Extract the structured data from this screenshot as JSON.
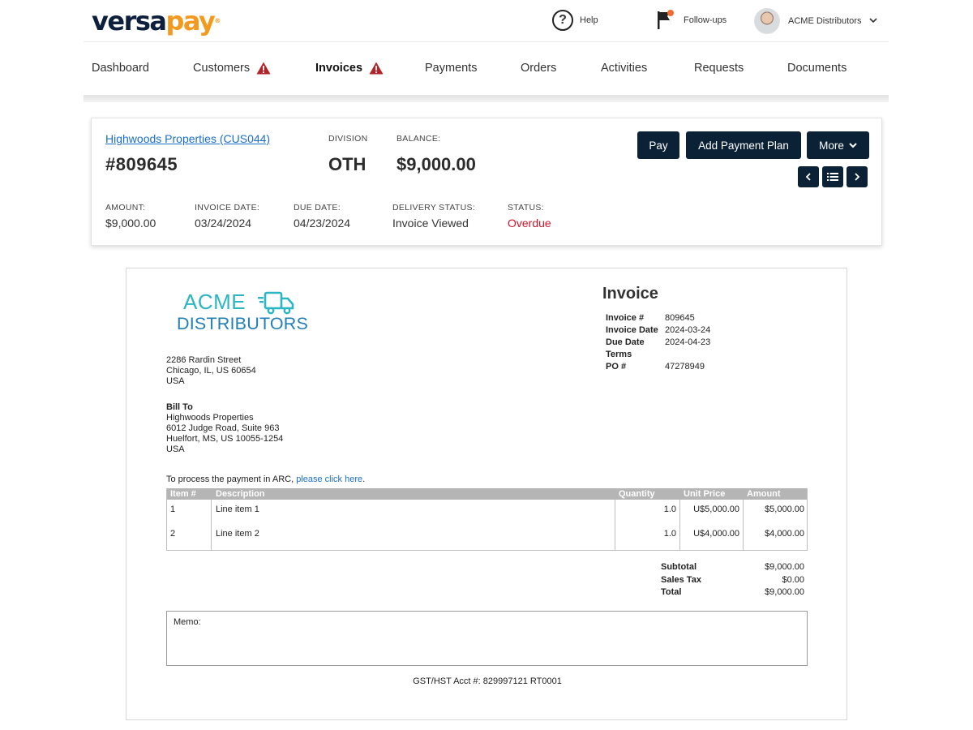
{
  "brand": {
    "logo_part1": "versa",
    "logo_part2": "pay",
    "logo_mark": "®",
    "primary_color": "#0b2236",
    "accent_color": "#f39a1e"
  },
  "header": {
    "help_label": "Help",
    "followups_label": "Follow-ups",
    "user_name": "ACME Distributors"
  },
  "nav": {
    "items": [
      {
        "label": "Dashboard",
        "warning": false,
        "active": false
      },
      {
        "label": "Customers",
        "warning": true,
        "active": false
      },
      {
        "label": "Invoices",
        "warning": true,
        "active": true
      },
      {
        "label": "Payments",
        "warning": false,
        "active": false
      },
      {
        "label": "Orders",
        "warning": false,
        "active": false
      },
      {
        "label": "Activities",
        "warning": false,
        "active": false
      },
      {
        "label": "Requests",
        "warning": false,
        "active": false
      },
      {
        "label": "Documents",
        "warning": false,
        "active": false
      }
    ]
  },
  "summary": {
    "customer_link": "Highwoods Properties (CUS044)",
    "invoice_number": "#809645",
    "division_label": "DIVISION",
    "division_value": "OTH",
    "balance_label": "BALANCE:",
    "balance_value": "$9,000.00",
    "amount_label": "AMOUNT:",
    "amount_value": "$9,000.00",
    "invoice_date_label": "INVOICE DATE:",
    "invoice_date_value": "03/24/2024",
    "due_date_label": "DUE DATE:",
    "due_date_value": "04/23/2024",
    "delivery_status_label": "DELIVERY STATUS:",
    "delivery_status_value": "Invoice Viewed",
    "status_label": "STATUS:",
    "status_value": "Overdue",
    "status_color": "#d0142c",
    "buttons": {
      "pay": "Pay",
      "add_plan": "Add Payment Plan",
      "more": "More"
    }
  },
  "document": {
    "logo_line1": "ACME",
    "logo_line2": "DISTRIBUTORS",
    "title": "Invoice",
    "from_address": [
      "2286 Rardin Street",
      "Chicago, IL, US 60654",
      "USA"
    ],
    "bill_to_label": "Bill To",
    "bill_to": [
      "Highwoods Properties",
      "6012 Judge Road, Suite 963",
      "Huelfort, MS, US 10055-1254",
      "USA"
    ],
    "meta": [
      {
        "key": "Invoice #",
        "value": "809645"
      },
      {
        "key": "Invoice Date",
        "value": "2024-03-24"
      },
      {
        "key": "Due Date",
        "value": "2024-04-23"
      },
      {
        "key": "Terms",
        "value": ""
      },
      {
        "key": "PO #",
        "value": "47278949"
      }
    ],
    "pay_text": "To process the payment in ARC, ",
    "pay_link": "please click here",
    "pay_suffix": ".",
    "table_headers": {
      "item": "Item #",
      "description": "Description",
      "quantity": "Quantity",
      "unit_price": "Unit Price",
      "amount": "Amount"
    },
    "line_items": [
      {
        "item": "1",
        "description": "Line item 1",
        "quantity": "1.0",
        "unit_price": "U$5,000.00",
        "amount": "$5,000.00"
      },
      {
        "item": "2",
        "description": "Line item 2",
        "quantity": "1.0",
        "unit_price": "U$4,000.00",
        "amount": "$4,000.00"
      }
    ],
    "totals": [
      {
        "key": "Subtotal",
        "value": "$9,000.00"
      },
      {
        "key": "Sales Tax",
        "value": "$0.00"
      },
      {
        "key": "Total",
        "value": "$9,000.00"
      }
    ],
    "memo_label": "Memo:",
    "gst_line": "GST/HST Acct #: 829997121 RT0001"
  }
}
